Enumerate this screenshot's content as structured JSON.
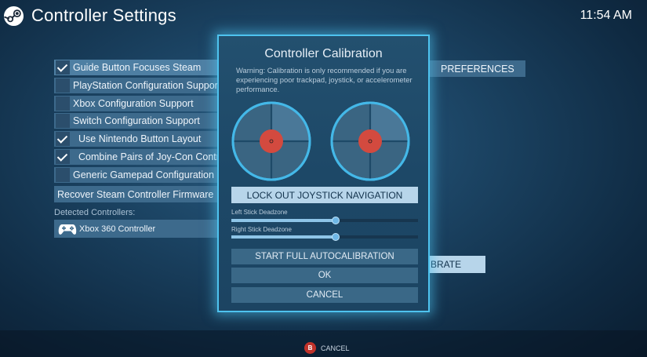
{
  "header": {
    "title": "Controller Settings",
    "time": "11:54 AM"
  },
  "settings": {
    "items": [
      {
        "label": "Guide Button Focuses Steam",
        "checked": true
      },
      {
        "label": "PlayStation Configuration Support",
        "checked": false
      },
      {
        "label": "Xbox Configuration Support",
        "checked": false
      },
      {
        "label": "Switch Configuration Support",
        "checked": false
      },
      {
        "label": "Use Nintendo Button Layout",
        "checked": true
      },
      {
        "label": "Combine Pairs of Joy-Con Controllers",
        "checked": true
      },
      {
        "label": "Generic Gamepad Configuration Support",
        "checked": false
      }
    ],
    "firmware": "Recover Steam Controller Firmware",
    "detected_label": "Detected Controllers:",
    "controller": "Xbox 360 Controller",
    "preferences_tab": "PREFERENCES",
    "calibrate_partial": "BRATE"
  },
  "modal": {
    "title": "Controller Calibration",
    "warning": "Warning: Calibration is only recommended if you are experiencing poor trackpad, joystick, or accelerometer performance.",
    "lockout_label": "LOCK OUT JOYSTICK NAVIGATION",
    "left_deadzone_label": "Left Stick Deadzone",
    "left_deadzone_value": 0.56,
    "right_deadzone_label": "Right Stick Deadzone",
    "right_deadzone_value": 0.56,
    "autocal_label": "START FULL AUTOCALIBRATION",
    "ok_label": "OK",
    "cancel_label": "CANCEL"
  },
  "footer": {
    "b_glyph": "B",
    "cancel_hint": "CANCEL"
  },
  "colors": {
    "accent": "#4ec3ef",
    "stick_center": "#d34a3f",
    "button_light": "#b7d5ea"
  }
}
